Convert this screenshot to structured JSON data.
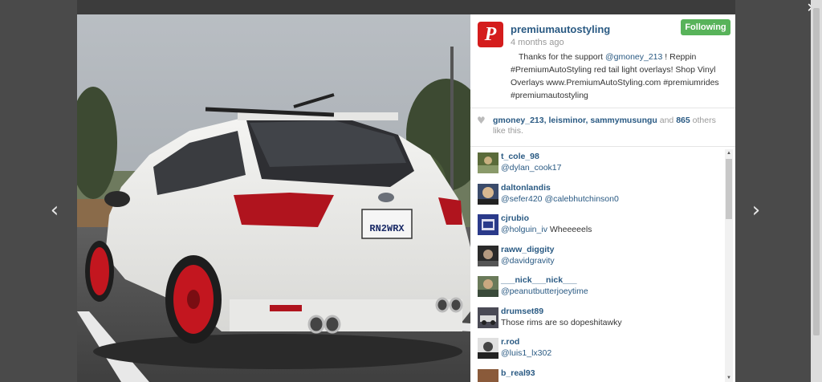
{
  "post": {
    "username": "premiumautostyling",
    "time_ago": "4 months ago",
    "follow_label": "Following",
    "caption_lead": "Thanks for the support ",
    "caption_mention": "@gmoney_213",
    "caption_rest": " ! Reppin #PremiumAutoStyling red tail light overlays! Shop Vinyl Overlays www.PremiumAutoStyling.com #premiumrides #premiumautostyling",
    "photo_plate": "RN2WRX"
  },
  "likes": {
    "names": "gmoney_213, leisminor, sammymusungu",
    "and": " and ",
    "count": "865",
    "suffix": " others like this."
  },
  "comments": [
    {
      "name": "t_cole_98",
      "mention": "@dylan_cook17",
      "text": ""
    },
    {
      "name": "daltonlandis",
      "mention": "@sefer420 @calebhutchinson0",
      "text": ""
    },
    {
      "name": "cjrubio",
      "mention": "@holguin_iv",
      "text": " Wheeeeels"
    },
    {
      "name": "raww_diggity",
      "mention": "@davidgravity",
      "text": ""
    },
    {
      "name": "___nick___nick___",
      "mention": "@peanutbutterjoeytime",
      "text": ""
    },
    {
      "name": "drumset89",
      "mention": "",
      "text": "Those rims are so dopeshitawky"
    },
    {
      "name": "r.rod",
      "mention": "@luis1_lx302",
      "text": ""
    },
    {
      "name": "b_real93",
      "mention": "",
      "text": ""
    }
  ],
  "nav": {
    "prev_glyph": "‹",
    "next_glyph": "›",
    "close_glyph": "✕"
  },
  "colors": {
    "follow": "#58b35a",
    "link": "#2a5a83",
    "logo": "#d41c1c"
  },
  "icons": {
    "like": "heart-icon",
    "logo": "premium-auto-styling-logo"
  }
}
